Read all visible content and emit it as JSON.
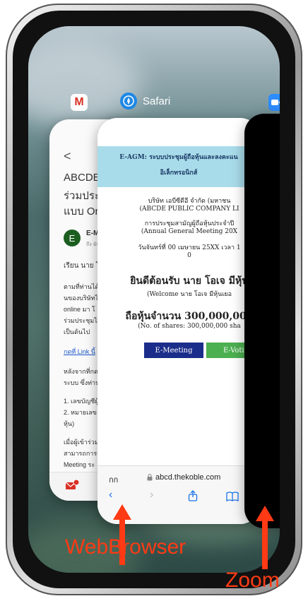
{
  "apps": {
    "safari_label": "Safari",
    "gmail_icon_letter": "M"
  },
  "gmail_card": {
    "back": "<",
    "subject_lines": [
      "ABCDE: ",
      "ร่วมประชุ",
      "แบบ Onli"
    ],
    "sender_initial": "E",
    "sender_name": "E-M",
    "sender_sub": "ถึง ฉัน",
    "body_lines": [
      "เรียน นาย โอ",
      "ตามที่ท่านได้",
      "นของบริษัทไ",
      "online มา โ",
      "ร่วมประชุมได้",
      "เป็นต้นไป"
    ],
    "link_text": "กดที่ Link นี้",
    "body_lines_2": [
      "หลังจากที่กด",
      "ระบบ ซึ่งท่าน"
    ],
    "list_lines": [
      "1. เลขบัญชีผู้",
      "2. หมายเลข",
      "หุ้น)"
    ],
    "body_lines_3": [
      "เมื่อผู้เข้าร่วม",
      "สามารถการรั",
      "Meeting ระ"
    ]
  },
  "safari_card": {
    "banner_line1": "E-AGM: ระบบประชุมผู้ถือหุ้นและลงคะแน",
    "banner_line2": "อิเล็กทรอนิกส์",
    "company_th": "บริษัท เอบีซีดีอี จำกัด (มหาชน",
    "company_en": "(ABCDE PUBLIC COMPANY LI",
    "meeting_th": "การประชุมสามัญผู้ถือหุ้นประจำปี",
    "meeting_en": "(Annual General Meeting 20X",
    "date_line": "วันจันทร์ที่ 00 เมษายน 25XX เวลา 1",
    "date_line2": "0",
    "welcome_th": "ยินดีต้อนรับ นาย โอเจ มีหุ้น",
    "welcome_en": "(Welcome นาย โอเจ มีหุ้นเยอ",
    "shares_th": "ถือหุ้นจำนวน 300,000,000",
    "shares_en": "(No. of shares: 300,000,000 sha",
    "btn_meeting": "E-Meeting",
    "btn_voting": "E-Votin",
    "url_left": "กก",
    "url": "abcd.thekoble.com",
    "colors": {
      "banner": "#a9dcea",
      "meeting_btn": "#1b2d8a",
      "voting_btn": "#4caf50"
    }
  },
  "annotations": {
    "web_browser": "WebBrowser",
    "zoom": "Zoom",
    "color": "#ff3a14"
  }
}
